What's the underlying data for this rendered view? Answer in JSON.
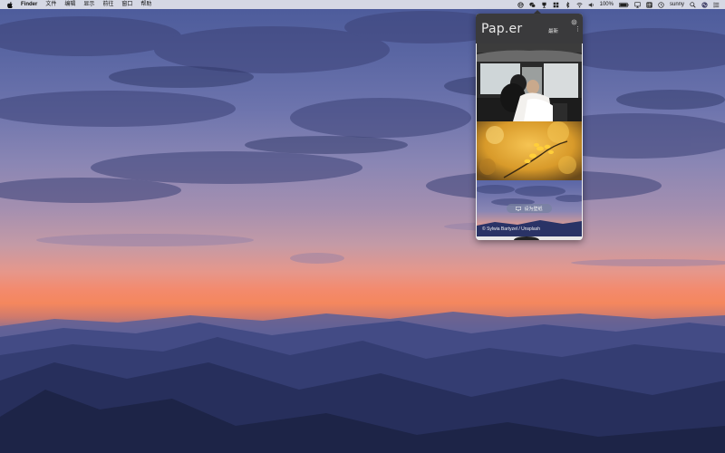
{
  "menubar": {
    "app_name": "Finder",
    "menus": [
      "文件",
      "编辑",
      "显示",
      "前往",
      "窗口",
      "帮助"
    ],
    "status": {
      "battery_percent": "100%",
      "user_name": "sunny",
      "icons": [
        "paper-status-icon",
        "wechat-icon",
        "trophy-icon",
        "grid-icon",
        "bluetooth-icon",
        "wifi-icon",
        "volume-icon",
        "battery-icon",
        "airplay-icon",
        "input-method-icon",
        "clock-icon",
        "search-icon",
        "siri-icon",
        "notification-center-icon"
      ]
    }
  },
  "app": {
    "logo": "Pap.er",
    "filter_label": "最新",
    "more_glyph": "⋮",
    "set_wallpaper_label": "设为壁纸",
    "photo_credit": "© Sylwia Bartyzel / Unsplash",
    "photos": [
      {
        "subject": "wedding-couple-in-car"
      },
      {
        "subject": "yellow-autumn-leaves"
      },
      {
        "subject": "sunset-clouds-mountains",
        "hovered": true
      },
      {
        "subject": "partial-next-photo"
      }
    ]
  },
  "colors": {
    "accent_header": "#3a3a3c",
    "menubar_bg": "#ececf0"
  }
}
